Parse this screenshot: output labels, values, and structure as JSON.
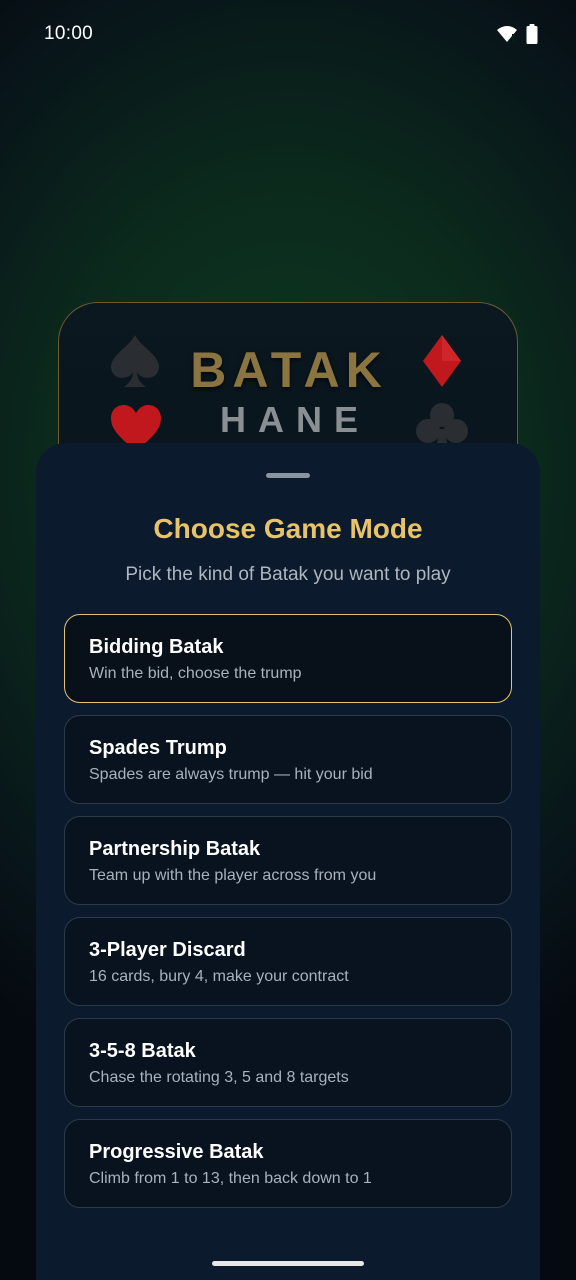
{
  "status_bar": {
    "time": "10:00",
    "icons": [
      "wifi-icon",
      "battery-icon"
    ]
  },
  "logo": {
    "title": "BATAK",
    "subtitle": "HANE",
    "suits": [
      "spade-icon",
      "diamond-icon",
      "heart-icon",
      "club-icon"
    ]
  },
  "sheet": {
    "title": "Choose Game Mode",
    "subtitle": "Pick the kind of Batak you want to play",
    "modes": [
      {
        "title": "Bidding Batak",
        "description": "Win the bid, choose the trump",
        "selected": true
      },
      {
        "title": "Spades Trump",
        "description": "Spades are always trump — hit your bid",
        "selected": false
      },
      {
        "title": "Partnership Batak",
        "description": "Team up with the player across from you",
        "selected": false
      },
      {
        "title": "3-Player Discard",
        "description": "16 cards, bury 4, make your contract",
        "selected": false
      },
      {
        "title": "3-5-8 Batak",
        "description": "Chase the rotating 3, 5 and 8 targets",
        "selected": false
      },
      {
        "title": "Progressive Batak",
        "description": "Climb from 1 to 13, then back down to 1",
        "selected": false
      }
    ]
  },
  "colors": {
    "accent_gold": "#e7c36a",
    "selected_border": "#e1c474",
    "sheet_bg": "#0b1a2c",
    "suit_red": "#c0181c",
    "suit_dark": "#2a2e33"
  }
}
